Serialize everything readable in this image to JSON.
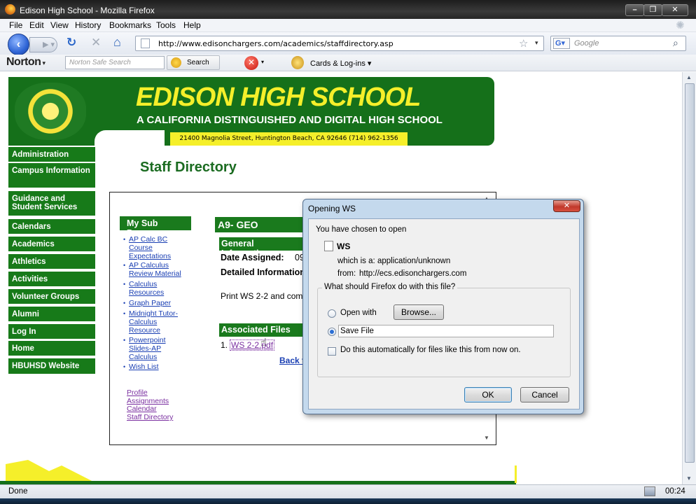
{
  "window": {
    "title": "Edison High School - Mozilla Firefox"
  },
  "menubar": {
    "items": [
      "File",
      "Edit",
      "View",
      "History",
      "Bookmarks",
      "Tools",
      "Help"
    ]
  },
  "navbar": {
    "url": "http://www.edisonchargers.com/academics/staffdirectory.asp",
    "search_placeholder": "Google"
  },
  "norton": {
    "logo": "Norton",
    "search_placeholder": "Norton Safe Search",
    "search_button": "Search",
    "cards_label": "Cards & Log-ins"
  },
  "site": {
    "name": "EDISON HIGH SCHOOL",
    "tagline": "A CALIFORNIA DISTINGUISHED AND DIGITAL HIGH SCHOOL",
    "address": "21400 Magnolia Street, Huntington Beach, CA 92646 (714) 962-1356",
    "nav": [
      "Administration",
      "Campus Information",
      "Guidance and Student Services",
      "Calendars",
      "Academics",
      "Athletics",
      "Activities",
      "Volunteer Groups",
      "Alumni",
      "Log In",
      "Home",
      "HBUHSD Website"
    ],
    "page_title": "Staff Directory"
  },
  "subpages": {
    "heading": "My Sub Pages",
    "links": [
      "AP Calc BC Course Expectations",
      "AP Calculus Review Material",
      "Calculus Resources",
      "Graph Paper",
      "Midnight Tutor- Calculus Resource",
      "Powerpoint Slides-AP Calculus",
      "Wish List"
    ],
    "bottom_links": [
      "Profile",
      "Assignments",
      "Calendar",
      "Staff Directory"
    ]
  },
  "assignment": {
    "heading": "A9- GEO",
    "general_heading": "General Information",
    "date_label": "Date Assigned:",
    "date_partial": "09",
    "detailed_label": "Detailed Information",
    "detail_text": "Print WS 2-2 and com",
    "assoc_heading": "Associated Files",
    "file_number": "1.",
    "file_link": "WS 2-2.pdf",
    "back_link": "Back to Assignments"
  },
  "dialog": {
    "title": "Opening WS",
    "chosen_label": "You have chosen to open",
    "filename": "WS",
    "which_is_label": "which is a:",
    "which_is_value": "application/unknown",
    "from_label": "from:",
    "from_value": "http://ecs.edisonchargers.com",
    "question": "What should Firefox do with this file?",
    "open_with_label": "Open with",
    "browse_button": "Browse...",
    "save_file_label": "Save File",
    "selected_option": "Save File",
    "auto_label": "Do this automatically for files like this from now on.",
    "ok_button": "OK",
    "cancel_button": "Cancel"
  },
  "status": {
    "text": "Done",
    "time": "00:24"
  },
  "colors": {
    "school_green": "#15701a",
    "school_yellow": "#f5ef2a",
    "link_blue": "#1a3fb3",
    "dialog_frame": "#c4d9ed"
  }
}
